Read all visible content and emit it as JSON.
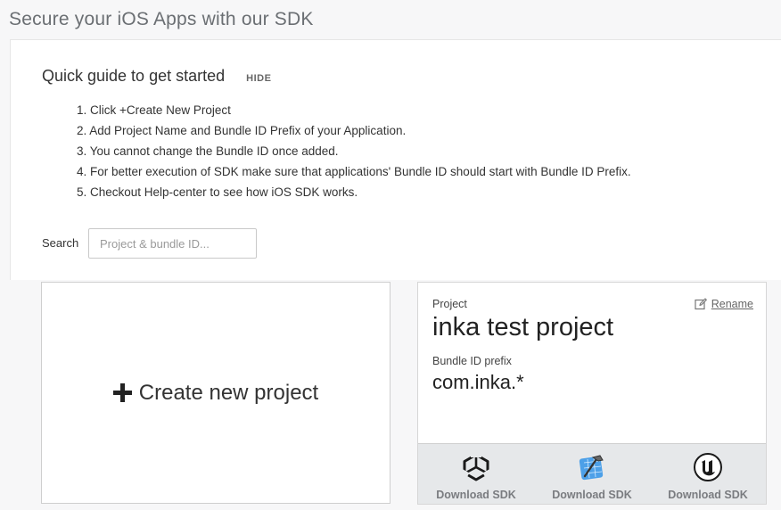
{
  "page": {
    "title": "Secure your iOS Apps with our SDK"
  },
  "guide": {
    "title": "Quick guide to get started",
    "hide_label": "HIDE",
    "steps": [
      "1. Click +Create New Project",
      "2. Add Project Name and Bundle ID Prefix of your Application.",
      "3. You cannot change the Bundle ID once added.",
      "4. For better execution of SDK make sure that applications' Bundle ID should start with Bundle ID Prefix.",
      "5. Checkout Help-center to see how iOS SDK works."
    ]
  },
  "search": {
    "label": "Search",
    "placeholder": "Project & bundle ID...",
    "value": ""
  },
  "create_card": {
    "label": "Create new project",
    "icon": "plus-icon"
  },
  "project_card": {
    "project_label": "Project",
    "project_name": "inka test project",
    "bundle_label": "Bundle ID prefix",
    "bundle_prefix": "com.inka.*",
    "rename_label": "Rename",
    "rename_icon": "edit-icon",
    "downloads": [
      {
        "icon": "unity-icon",
        "label": "Download SDK"
      },
      {
        "icon": "xcode-icon",
        "label": "Download SDK"
      },
      {
        "icon": "unreal-icon",
        "label": "Download SDK"
      }
    ]
  }
}
